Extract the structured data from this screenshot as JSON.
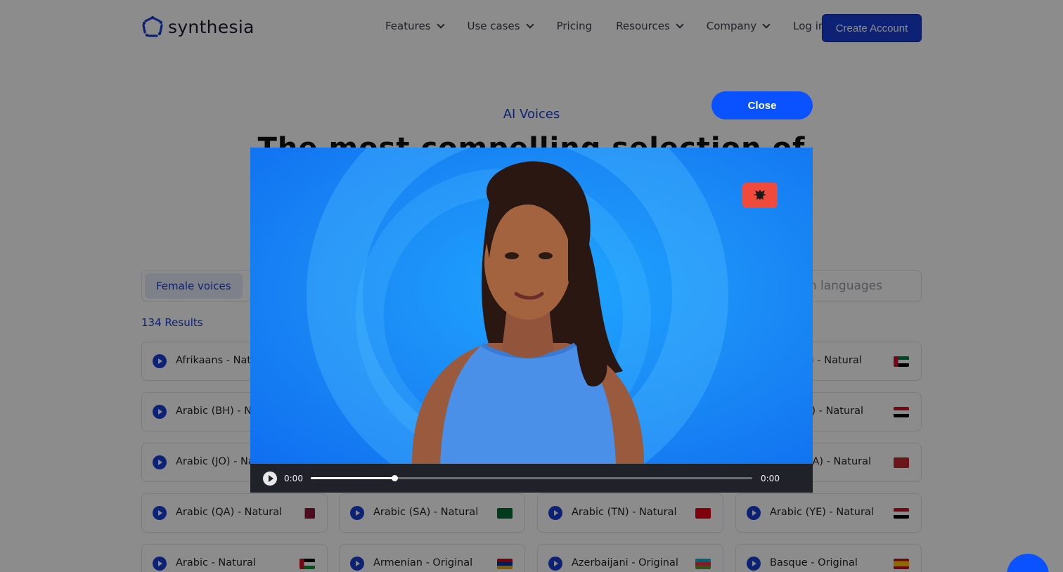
{
  "header": {
    "logo_text": "synthesia",
    "nav": [
      {
        "label": "Features",
        "dropdown": true
      },
      {
        "label": "Use cases",
        "dropdown": true
      },
      {
        "label": "Pricing",
        "dropdown": false
      },
      {
        "label": "Resources",
        "dropdown": true
      },
      {
        "label": "Company",
        "dropdown": true
      },
      {
        "label": "Log in",
        "dropdown": false
      }
    ],
    "create_account": "Create Account"
  },
  "hero": {
    "eyebrow": "AI Voices",
    "title": "The most compelling selection of"
  },
  "filters": {
    "female_tab": "Female voices",
    "search_placeholder_visible": "h languages",
    "results": "134 Results"
  },
  "voices": [
    {
      "label": "Afrikaans - Natu",
      "flag": "none"
    },
    {
      "label": "E) - Natural",
      "flag": "ae"
    },
    {
      "label": "Arabic (BH) - Na",
      "flag": "none"
    },
    {
      "label": "Q) - Natural",
      "flag": "iq"
    },
    {
      "label": "Arabic (JO) - Na",
      "flag": "none"
    },
    {
      "label": "MA) - Natural",
      "flag": "ma"
    },
    {
      "label": "Arabic (QA) - Natural",
      "flag": "qa"
    },
    {
      "label": "Arabic (SA) - Natural",
      "flag": "sa"
    },
    {
      "label": "Arabic (TN) - Natural",
      "flag": "tn"
    },
    {
      "label": "Arabic (YE) - Natural",
      "flag": "ye"
    },
    {
      "label": "Arabic - Natural",
      "flag": "ps"
    },
    {
      "label": "Armenian - Original",
      "flag": "am"
    },
    {
      "label": "Azerbaijani - Original",
      "flag": "az"
    },
    {
      "label": "Basque - Original",
      "flag": "es"
    }
  ],
  "modal": {
    "close_label": "Close",
    "player": {
      "current_time": "0:00",
      "duration": "0:00",
      "progress": 0.19
    },
    "badge_icon": "albania-eagle-icon"
  },
  "colors": {
    "brand": "#1b3fd6",
    "close_button": "#0a52ff",
    "badge": "#f04a3c"
  }
}
